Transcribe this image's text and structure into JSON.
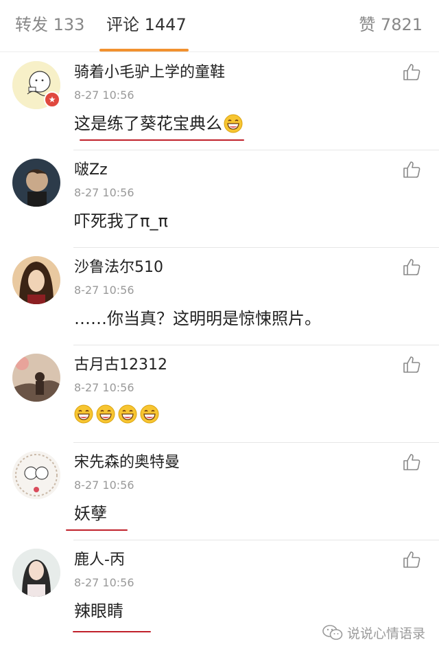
{
  "tabs": [
    {
      "label": "转发",
      "count": "133"
    },
    {
      "label": "评论",
      "count": "1447"
    },
    {
      "label": "赞",
      "count": "7821"
    }
  ],
  "active_tab": "评论 1447",
  "comments": [
    {
      "user": "骑着小毛驴上学的童鞋",
      "time": "8-27 10:56",
      "text": "这是练了葵花宝典么",
      "emoji": [
        "laugh-emoji"
      ],
      "vip_badge": "★"
    },
    {
      "user": "啵Zz",
      "time": "8-27 10:56",
      "text": "吓死我了π_π"
    },
    {
      "user": "沙鲁法尔510",
      "time": "8-27 10:56",
      "text": "……你当真？这明明是惊悚照片。"
    },
    {
      "user": "古月古12312",
      "time": "8-27 10:56",
      "text": "",
      "emoji": [
        "laugh-emoji",
        "laugh-emoji",
        "laugh-emoji",
        "laugh-emoji"
      ]
    },
    {
      "user": "宋先森的奥特曼",
      "time": "8-27 10:56",
      "text": "妖孽"
    },
    {
      "user": "鹿人-丙",
      "time": "8-27 10:56",
      "text": "辣眼睛"
    }
  ],
  "watermark": {
    "text": "说说心情语录",
    "icon": "wechat-icon"
  },
  "colors": {
    "tab_underline": "#f2912f",
    "annotation_red": "#c0202a",
    "vip_badge": "#e0483e"
  }
}
